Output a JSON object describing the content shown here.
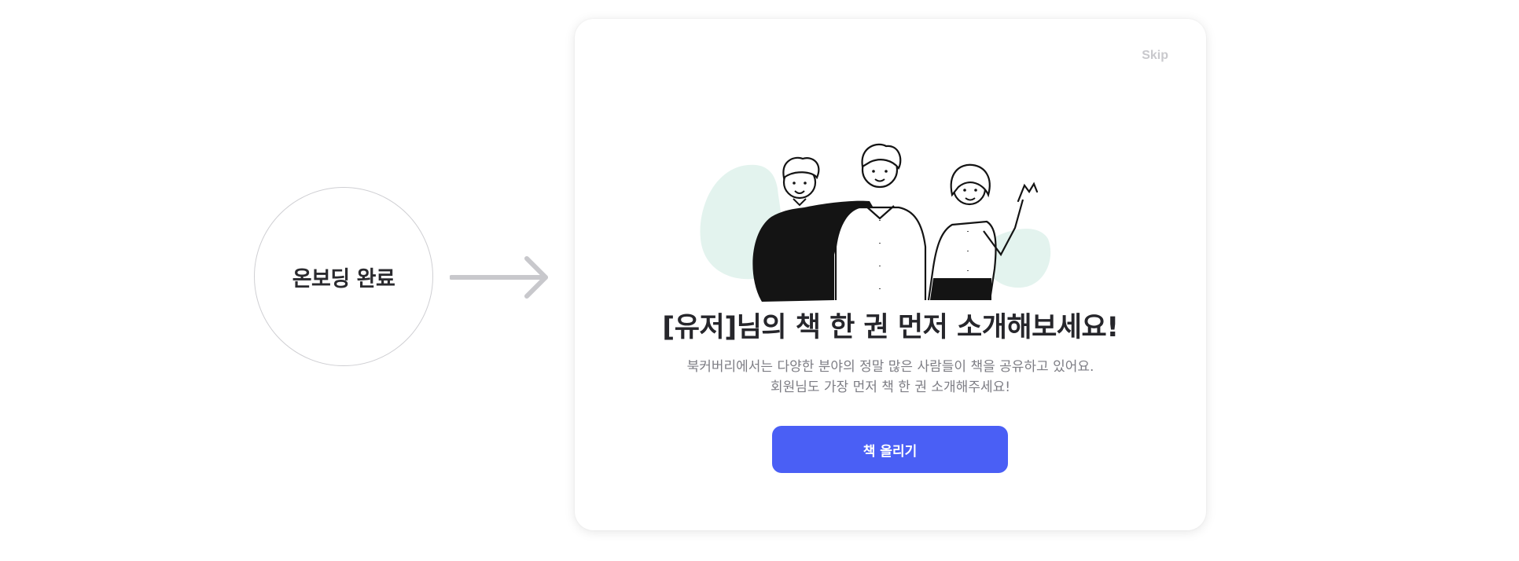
{
  "flow": {
    "step_label": "온보딩 완료"
  },
  "modal": {
    "skip_label": "Skip",
    "title": "[유저]님의 책 한 권 먼저 소개해보세요!",
    "description_lines": [
      "북커버리에서는 다양한 분야의 정말 많은 사람들이 책을 공유하고 있어요.",
      "회원님도 가장 먼저 책 한 권 소개해주세요!"
    ],
    "cta_label": "책 올리기"
  },
  "colors": {
    "accent": "#4a5ff5",
    "illustration_blob": "#e3f3ee",
    "text_dark": "#26262b",
    "text_muted": "#7d7d84",
    "skip": "#c9c9cd"
  },
  "icons": {
    "arrow": "arrow-right-icon",
    "illustration": "three-people-illustration"
  }
}
